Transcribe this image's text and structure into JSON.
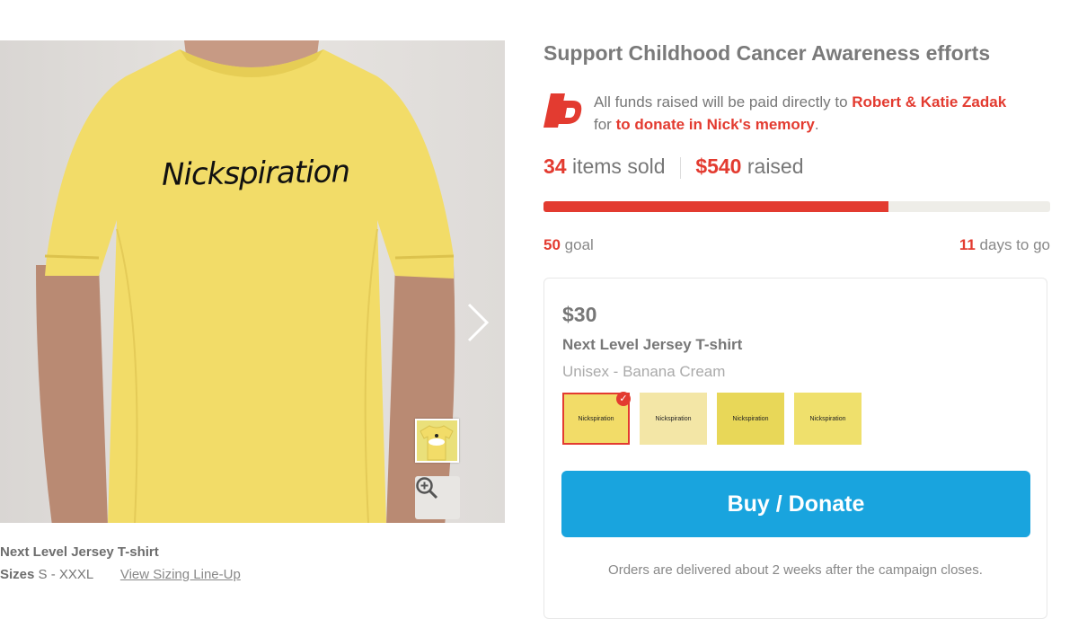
{
  "campaign": {
    "title": "Support Childhood Cancer Awareness efforts",
    "funds_prefix": "All funds raised will be paid directly to ",
    "beneficiary": "Robert & Katie Zadak",
    "funds_mid": " for ",
    "cause": "to donate in Nick's memory",
    "funds_suffix": "."
  },
  "stats": {
    "items_sold": "34",
    "items_label": "items sold",
    "raised": "$540",
    "raised_label": "raised",
    "progress_fraction": 0.68,
    "goal": "50",
    "goal_label": "goal",
    "days": "11",
    "days_label": "days to go"
  },
  "product": {
    "price": "$30",
    "name": "Next Level Jersey T-shirt",
    "style": "Unisex - Banana Cream",
    "shirt_print": "Nickspiration",
    "swatches": [
      {
        "color": "#f2dc68",
        "label": "Nickspiration",
        "selected": true
      },
      {
        "color": "#f3e6a6",
        "label": "Nickspiration",
        "selected": false
      },
      {
        "color": "#e8d758",
        "label": "Nickspiration",
        "selected": false
      },
      {
        "color": "#efe06c",
        "label": "Nickspiration",
        "selected": false
      }
    ],
    "buy_label": "Buy / Donate",
    "delivery_note": "Orders are delivered about 2 weeks after the campaign closes."
  },
  "caption": {
    "title": "Next Level Jersey T-shirt",
    "sizes_label": "Sizes",
    "sizes_value": "S - XXXL",
    "sizing_link": "View Sizing Line-Up"
  },
  "colors": {
    "accent_red": "#e33b30",
    "button_blue": "#19a4de",
    "shirt_yellow": "#f2dc68"
  },
  "icons": {
    "logo": "bonfire-logo",
    "next": "chevron-right-icon",
    "zoom": "zoom-in-icon",
    "check": "check-icon"
  }
}
